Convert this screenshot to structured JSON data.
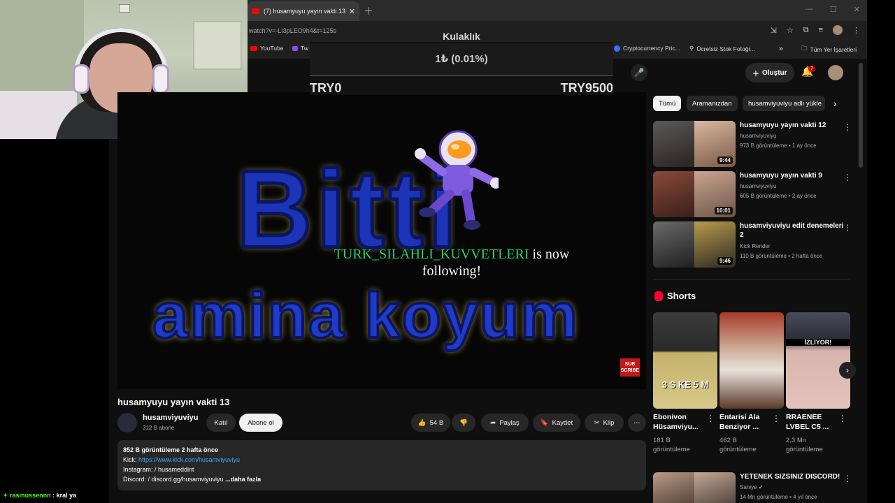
{
  "browser": {
    "tab_title": "(7) husamyuyu yayın vakti 13 -",
    "url": "watch?v=-LI3pLEO9h4&t=125s",
    "bookmarks": [
      "YouTube",
      "Tw",
      "Cryptocurrency Pric...",
      "Ücretsiz Stok Fotoğr...",
      "»",
      "Tüm Yer İşaretleri"
    ]
  },
  "overlay": {
    "title": "Kulaklık",
    "amount": "1₺ (0.01%)",
    "min": "TRY0",
    "max": "TRY9500"
  },
  "youtube": {
    "create_label": "Oluştur",
    "notif_count": "7",
    "video": {
      "text_big": "Bitti",
      "text_big2": "amina koyum",
      "follower": "TURK_SILAHLI_KUVVETLERI",
      "follow_text": " is now following!",
      "sub_badge": "SUB SCRIBE",
      "title": "husamyuyu yayın vakti 13",
      "channel": "husamviyuviyu",
      "subs": "312 B abone",
      "join_label": "Katıl",
      "subscribe_label": "Abone ol",
      "likes": "54 B",
      "share_label": "Paylaş",
      "save_label": "Kaydet",
      "clip_label": "Klip",
      "desc_stats": "852 B görüntüleme  2 hafta önce",
      "desc_kick_label": "Kick: ",
      "desc_kick_link": "https://www.kick.com/husamviyuviyu",
      "desc_instagram": " Instagram:   / husameddint",
      "desc_discord": " Discord:   / discord.gg/husamviyuviyu",
      "desc_more": "...daha fazla"
    },
    "chips": [
      "Tümü",
      "Aramanızdan",
      "husamviyuviyu adlı yükle"
    ],
    "recommendations": [
      {
        "title": "husamyuyu yayın vakti 12",
        "channel": "husamviyuviyu",
        "meta": "973 B görüntüleme • 1 ay önce",
        "duration": "9:44"
      },
      {
        "title": "husamyuyu yayın vakti 9",
        "channel": "husamviyuviyu",
        "meta": "605 B görüntüleme • 2 ay önce",
        "duration": "10:01"
      },
      {
        "title": "husamviyuviyu edit denemeleri 2",
        "channel": "Kick Render",
        "meta": "110 B görüntüleme • 2 hafta önce",
        "duration": "9:46"
      }
    ],
    "shorts_heading": "Shorts",
    "shorts": [
      {
        "title": "Ebonivon Hüsamviyu...",
        "views": "181 B görüntüleme",
        "overlay_text": "3 S KE 5 M"
      },
      {
        "title": "Entarisi Ala Benziyor ...",
        "views": "462 B görüntüleme",
        "overlay_text": ""
      },
      {
        "title": "RRAENEE LVBEL C5 ...",
        "views": "2,3 Mn görüntüleme",
        "overlay_text": "İZLİYOR!"
      }
    ],
    "bottom_rec": {
      "title": "YETENEK SIZSINIZ DISCORD!",
      "channel": "Saniye",
      "meta": "14 Mn görüntüleme • 4 yıl önce"
    }
  },
  "chat": {
    "user": "rasmussennn",
    "message": " : kral ya"
  }
}
